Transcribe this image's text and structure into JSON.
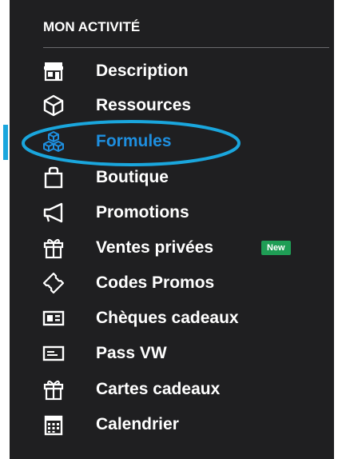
{
  "section": {
    "title": "MON ACTIVITÉ"
  },
  "menu": {
    "items": [
      {
        "label": "Description",
        "icon": "storefront-icon"
      },
      {
        "label": "Ressources",
        "icon": "cube-icon"
      },
      {
        "label": "Formules",
        "icon": "cubes-icon",
        "active": true
      },
      {
        "label": "Boutique",
        "icon": "shopping-bag-icon"
      },
      {
        "label": "Promotions",
        "icon": "megaphone-icon"
      },
      {
        "label": "Ventes privées",
        "icon": "gift-icon",
        "badge": "New"
      },
      {
        "label": "Codes Promos",
        "icon": "ticket-icon"
      },
      {
        "label": "Chèques cadeaux",
        "icon": "voucher-card-icon"
      },
      {
        "label": "Pass VW",
        "icon": "pass-card-icon"
      },
      {
        "label": "Cartes cadeaux",
        "icon": "gift-card-icon"
      },
      {
        "label": "Calendrier",
        "icon": "calendar-icon"
      }
    ]
  },
  "colors": {
    "panel_background": "#1f1f21",
    "text": "#ffffff",
    "active_text": "#1e8fe0",
    "highlight": "#1aa6dd",
    "badge_background": "#1f9d55"
  }
}
